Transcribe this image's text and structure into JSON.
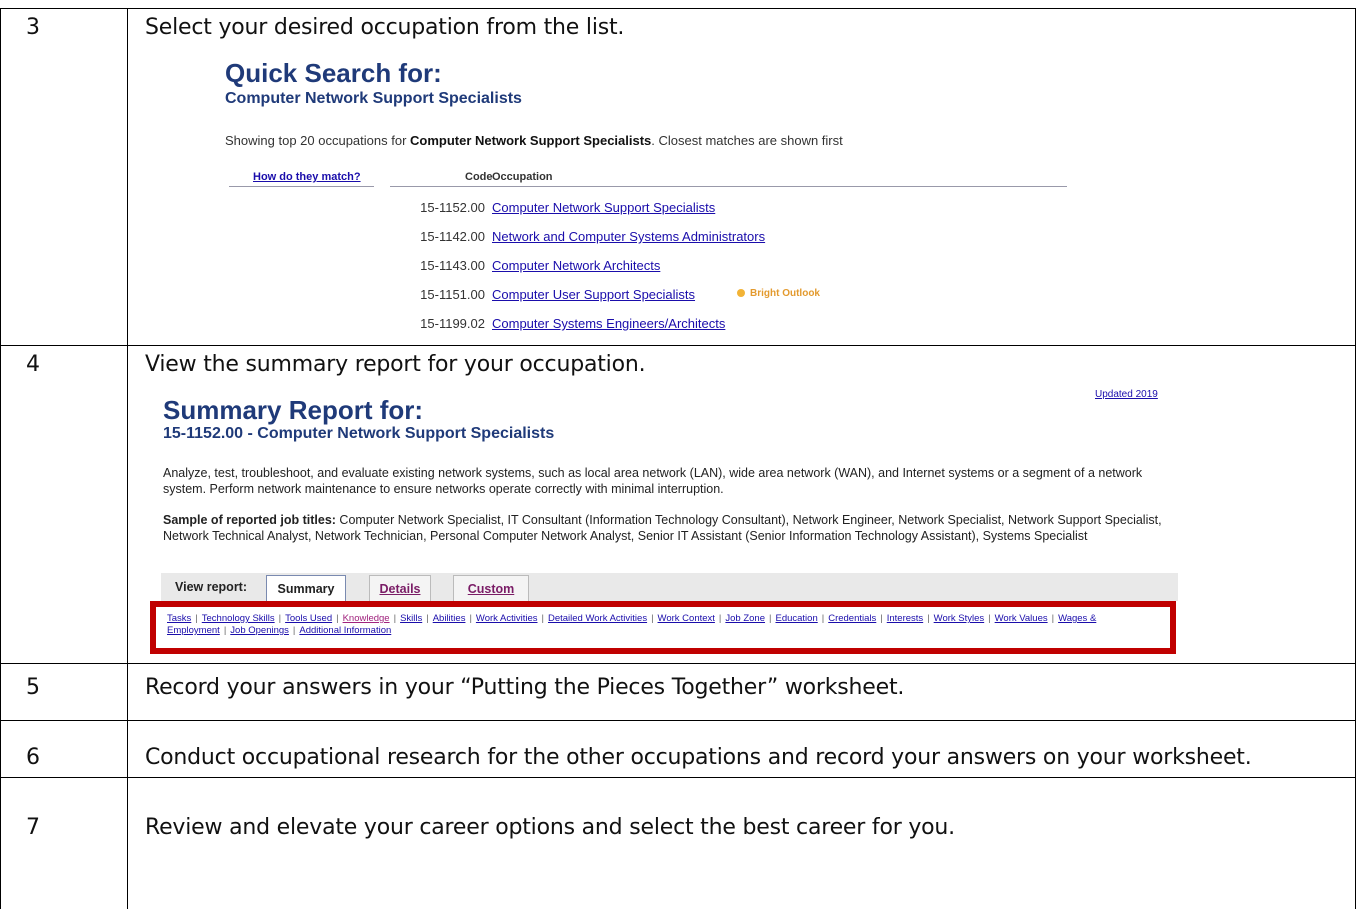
{
  "steps": [
    {
      "num": "3",
      "text": "Select your desired occupation from the list."
    },
    {
      "num": "4",
      "text": "View the summary report for your occupation."
    },
    {
      "num": "5",
      "text": "Record your answers in your “Putting the Pieces Together” worksheet."
    },
    {
      "num": "6",
      "text": "Conduct occupational research for the other occupations and record your answers on your worksheet."
    },
    {
      "num": "7",
      "text": "Review and elevate your career options and select the best career for you."
    }
  ],
  "quick_search": {
    "title": "Quick Search for:",
    "subtitle": "Computer Network Support Specialists",
    "showing_prefix": "Showing top 20 occupations for ",
    "showing_bold": "Computer Network Support Specialists",
    "showing_suffix": ". Closest matches are shown first",
    "how_match": "How do they match?",
    "code_header": "Code",
    "occupation_header": "Occupation",
    "rows": [
      {
        "code": "15-1152.00",
        "occupation": "Computer Network Support Specialists"
      },
      {
        "code": "15-1142.00",
        "occupation": "Network and Computer Systems Administrators"
      },
      {
        "code": "15-1143.00",
        "occupation": "Computer Network Architects"
      },
      {
        "code": "15-1151.00",
        "occupation": "Computer User Support Specialists"
      },
      {
        "code": "15-1199.02",
        "occupation": "Computer Systems Engineers/Architects"
      }
    ],
    "bright_outlook": "Bright Outlook"
  },
  "summary_report": {
    "updated": "Updated 2019",
    "title": "Summary Report for:",
    "subtitle": "15-1152.00 - Computer Network Support Specialists",
    "description": "Analyze, test, troubleshoot, and evaluate existing network systems, such as local area network (LAN), wide area network (WAN), and Internet systems or a segment of a network system. Perform network maintenance to ensure networks operate correctly with minimal interruption.",
    "sample_label": "Sample of reported job titles:",
    "sample_titles": " Computer Network Specialist, IT Consultant (Information Technology Consultant), Network Engineer, Network Specialist, Network Support Specialist, Network Technical Analyst, Network Technician, Personal Computer Network Analyst, Senior IT Assistant (Senior Information Technology Assistant), Systems Specialist",
    "view_report": "View report:",
    "tabs": {
      "summary": "Summary",
      "details": "Details",
      "custom": "Custom"
    },
    "section_links": [
      "Tasks",
      "Technology Skills",
      "Tools Used",
      "Knowledge",
      "Skills",
      "Abilities",
      "Work Activities",
      "Detailed Work Activities",
      "Work Context",
      "Job Zone",
      "Education",
      "Credentials",
      "Interests",
      "Work Styles",
      "Work Values",
      "Wages & Employment",
      "Job Openings",
      "Additional Information"
    ]
  },
  "colors": {
    "heading_blue": "#1f3a79",
    "link_blue": "#1a0dab",
    "highlight_red": "#c00000",
    "bright_outlook": "#e39a2e"
  }
}
